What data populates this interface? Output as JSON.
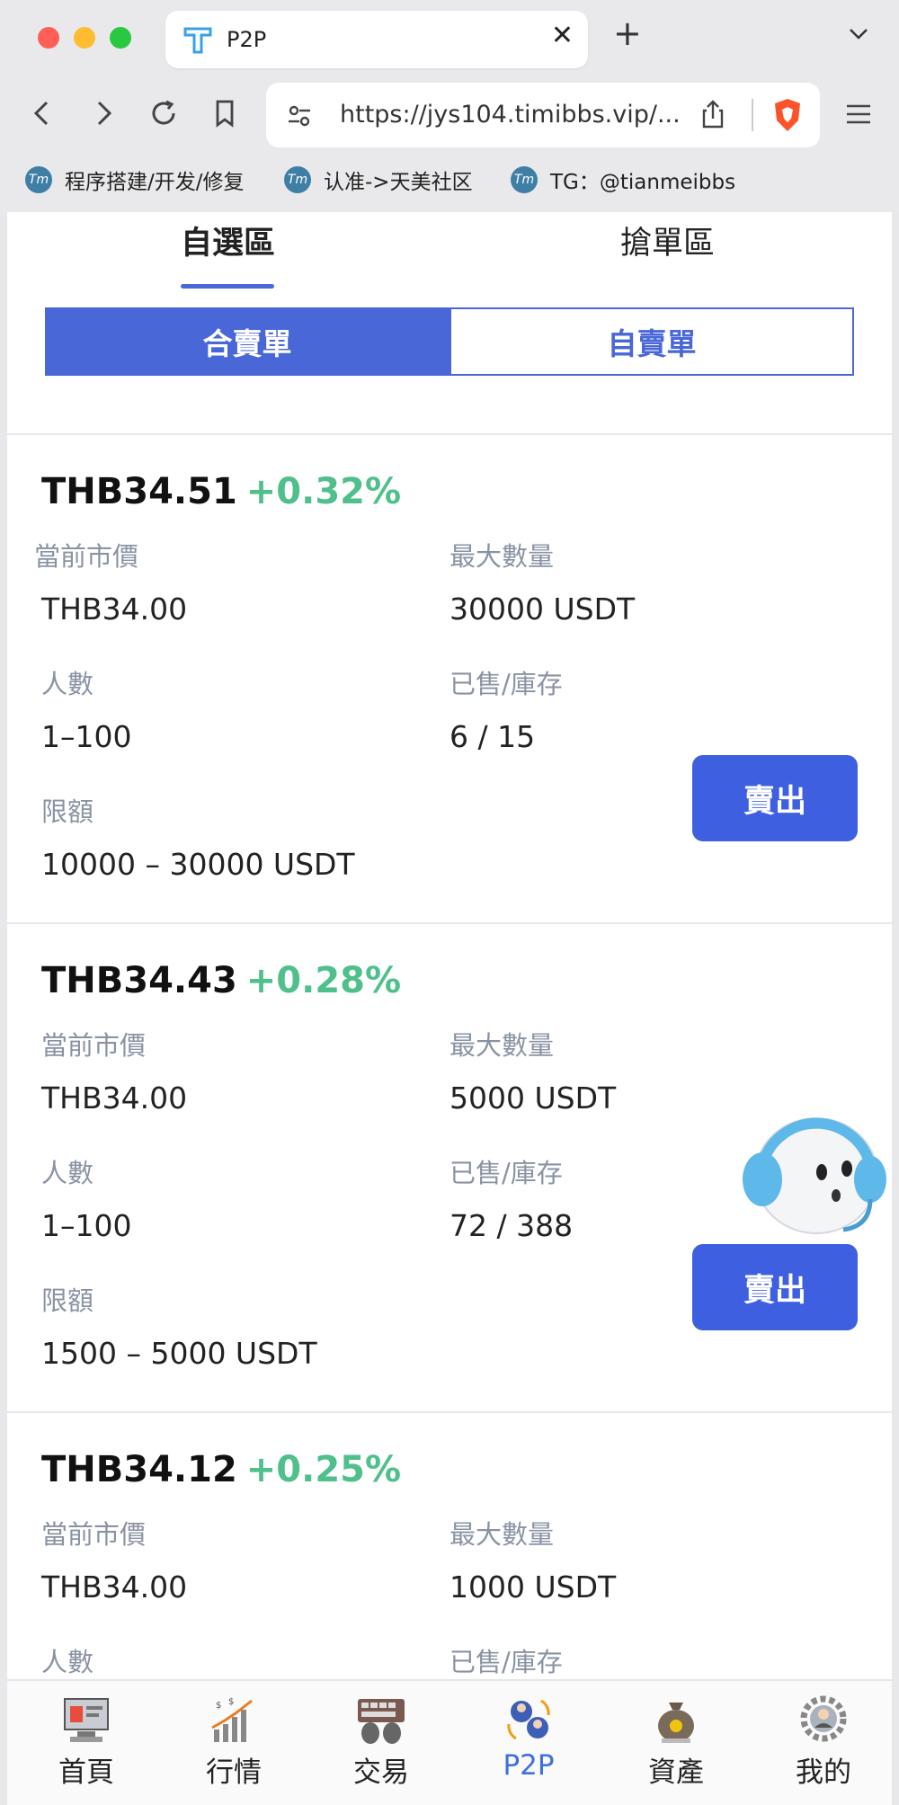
{
  "browser": {
    "tab_title": "P2P",
    "url": "https://jys104.timibbs.vip/...",
    "bookmarks": [
      {
        "label": "程序搭建/开发/修复",
        "logo": "Tm"
      },
      {
        "label": "认准->天美社区",
        "logo": "Tm"
      },
      {
        "label": "TG：@tianmeibbs",
        "logo": "Tm"
      }
    ],
    "colors": {
      "close": "#ff5f57",
      "minimize": "#febc2e",
      "maximize": "#28c840"
    }
  },
  "tabs": {
    "selected": "自選區",
    "grab": "搶單區"
  },
  "segments": {
    "combined": "合賣單",
    "self": "自賣單"
  },
  "labels": {
    "market_price": "當前市價",
    "max_qty": "最大數量",
    "people": "人數",
    "sold_stock": "已售/庫存",
    "limit": "限額",
    "sell_button": "賣出"
  },
  "offers": [
    {
      "price": "THB34.51",
      "change": "+0.32%",
      "market": "THB34.00",
      "max": "30000 USDT",
      "people": "1–100",
      "sold_stock": "6 / 15",
      "limit": "10000 – 30000 USDT"
    },
    {
      "price": "THB34.43",
      "change": "+0.28%",
      "market": "THB34.00",
      "max": "5000 USDT",
      "people": "1–100",
      "sold_stock": "72 / 388",
      "limit": "1500 – 5000 USDT"
    },
    {
      "price": "THB34.12",
      "change": "+0.25%",
      "market": "THB34.00",
      "max": "1000 USDT"
    }
  ],
  "bottom_nav": [
    {
      "label": "首頁",
      "icon": "home-icon"
    },
    {
      "label": "行情",
      "icon": "market-chart-icon"
    },
    {
      "label": "交易",
      "icon": "keyboard-trade-icon"
    },
    {
      "label": "P2P",
      "icon": "p2p-exchange-icon"
    },
    {
      "label": "資產",
      "icon": "money-bag-icon"
    },
    {
      "label": "我的",
      "icon": "profile-gear-icon"
    }
  ],
  "colors": {
    "accent": "#4a67d8",
    "positive": "#4fbf8c",
    "button": "#3d5fe0"
  }
}
